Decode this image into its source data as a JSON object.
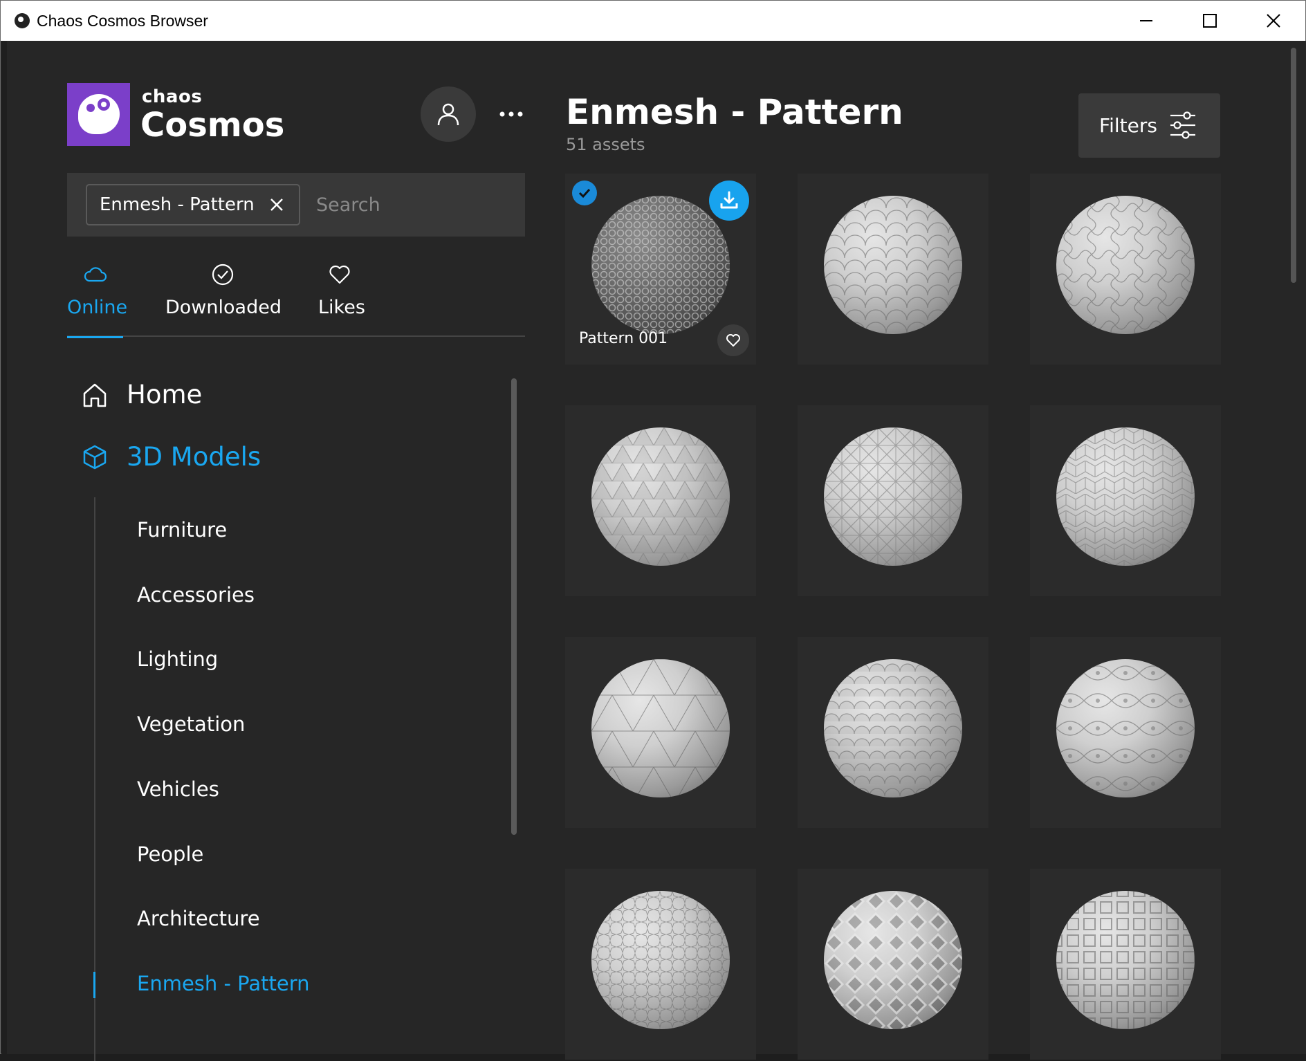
{
  "window": {
    "title": "Chaos Cosmos Browser"
  },
  "brand": {
    "small": "chaos",
    "big": "Cosmos"
  },
  "search": {
    "chip_label": "Enmesh - Pattern",
    "placeholder": "Search"
  },
  "tabs": [
    {
      "label": "Online",
      "icon": "cloud-icon"
    },
    {
      "label": "Downloaded",
      "icon": "check-circle-icon"
    },
    {
      "label": "Likes",
      "icon": "heart-icon"
    }
  ],
  "nav": {
    "home": "Home",
    "models": "3D Models",
    "sub_items": [
      "Furniture",
      "Accessories",
      "Lighting",
      "Vegetation",
      "Vehicles",
      "People",
      "Architecture",
      "Enmesh - Pattern"
    ]
  },
  "content": {
    "title": "Enmesh - Pattern",
    "count": "51 assets",
    "filters_label": "Filters",
    "first_card_label": "Pattern 001"
  },
  "colors": {
    "accent": "#1aa7f0",
    "brand": "#7b3fc9",
    "background": "#262626"
  }
}
